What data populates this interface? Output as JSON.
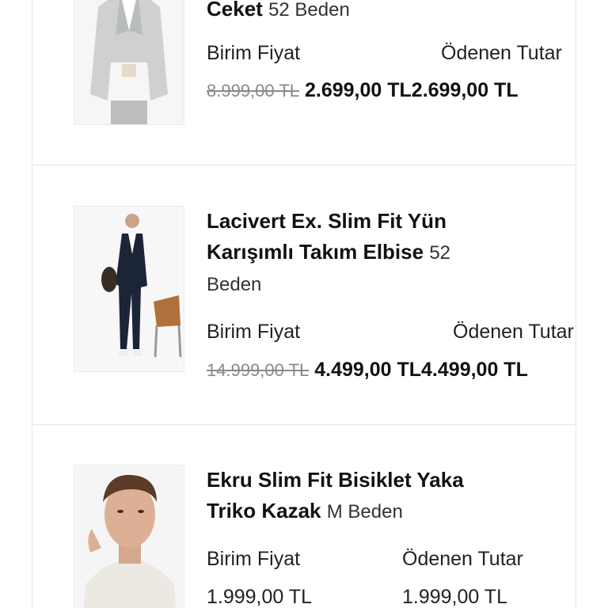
{
  "items": [
    {
      "title_tail": "Ceket",
      "size": "52 Beden",
      "unit_price_label": "Birim Fiyat",
      "paid_label": "Ödenen Tutar",
      "old_price": "8.999,00 TL",
      "unit_price": "2.699,00 TL",
      "paid_price": "2.699,00 TL"
    },
    {
      "title": "Lacivert Ex. Slim Fit Yün Karışımlı Takım Elbise",
      "size": "52 Beden",
      "unit_price_label": "Birim Fiyat",
      "paid_label": "Ödenen Tutar",
      "old_price": "14.999,00 TL",
      "unit_price": "4.499,00 TL",
      "paid_price": "4.499,00 TL"
    },
    {
      "title": "Ekru Slim Fit Bisiklet Yaka Triko Kazak",
      "size": "M Beden",
      "unit_price_label": "Birim Fiyat",
      "paid_label": "Ödenen Tutar",
      "unit_price": "1.999,00 TL",
      "paid_price": "1.999,00 TL"
    }
  ]
}
